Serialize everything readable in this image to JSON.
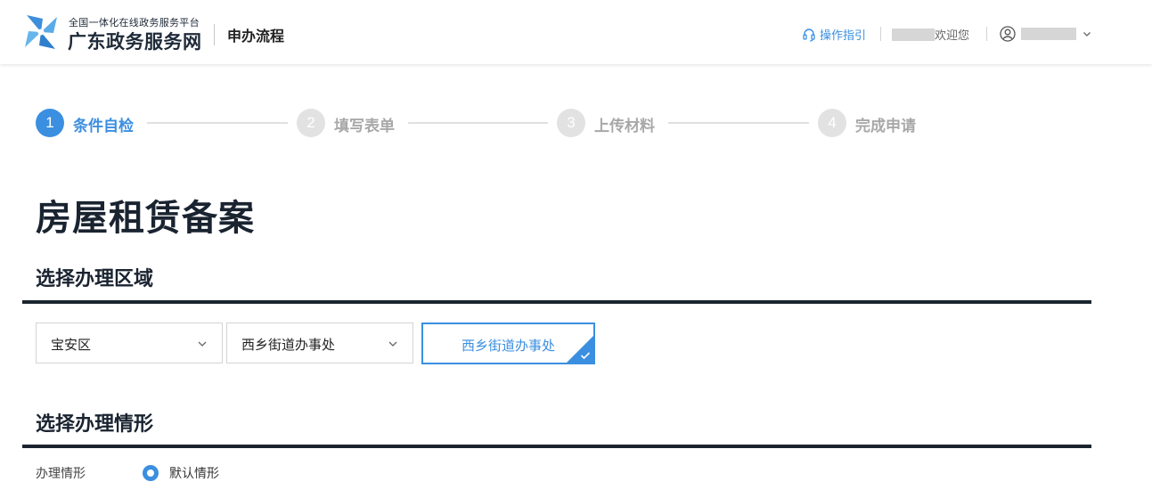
{
  "header": {
    "logo_sub": "全国一体化在线政务服务平台",
    "logo_main": "广东政务服务网",
    "process_label": "申办流程",
    "guide_label": "操作指引",
    "welcome_text": "欢迎您",
    "icons": {
      "logo": "pinwheel-logo-icon",
      "guide": "headset-icon",
      "user": "user-circle-icon",
      "dropdown": "chevron-down-icon"
    }
  },
  "steps": [
    {
      "number": "1",
      "label": "条件自检",
      "state": "active"
    },
    {
      "number": "2",
      "label": "填写表单",
      "state": "todo"
    },
    {
      "number": "3",
      "label": "上传材料",
      "state": "todo"
    },
    {
      "number": "4",
      "label": "完成申请",
      "state": "todo"
    }
  ],
  "page_title": "房屋租赁备案",
  "region_section": {
    "title": "选择办理区域",
    "district_select": {
      "value": "宝安区"
    },
    "street_select": {
      "value": "西乡街道办事处"
    },
    "selected_office": {
      "label": "西乡街道办事处",
      "icon": "check-icon"
    }
  },
  "situation_section": {
    "title": "选择办理情形",
    "field_label": "办理情形",
    "default_option": {
      "label": "默认情形",
      "selected": true
    }
  },
  "colors": {
    "accent": "#3b8fe0",
    "inactive": "#e2e2e2",
    "dark_text": "#1a2330"
  }
}
